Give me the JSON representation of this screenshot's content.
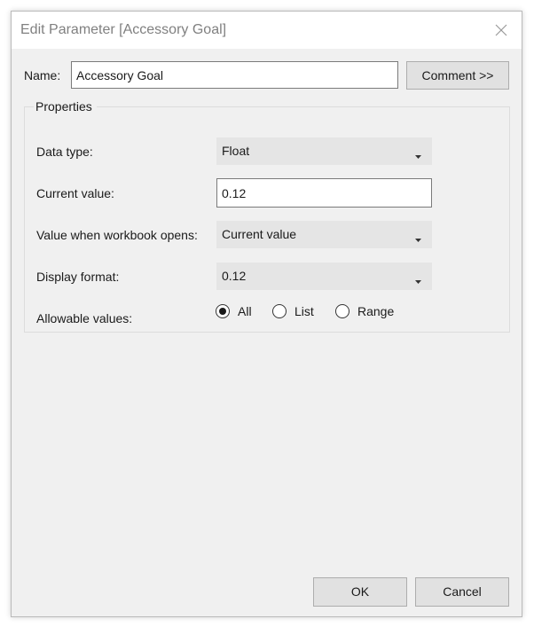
{
  "window": {
    "title": "Edit Parameter [Accessory Goal]"
  },
  "name": {
    "label": "Name:",
    "value": "Accessory Goal"
  },
  "buttons": {
    "comment": "Comment >>",
    "ok": "OK",
    "cancel": "Cancel"
  },
  "properties": {
    "legend": "Properties",
    "data_type": {
      "label": "Data type:",
      "value": "Float"
    },
    "current_value": {
      "label": "Current value:",
      "value": "0.12"
    },
    "workbook_opens": {
      "label": "Value when workbook opens:",
      "value": "Current value"
    },
    "display_format": {
      "label": "Display format:",
      "value": "0.12"
    },
    "allowable_values": {
      "label": "Allowable values:",
      "options": [
        {
          "label": "All",
          "selected": true
        },
        {
          "label": "List",
          "selected": false
        },
        {
          "label": "Range",
          "selected": false
        }
      ]
    }
  },
  "icons": {
    "close": "close-icon",
    "dropdown": "chevron-down-icon"
  },
  "colors": {
    "dialog_bg": "#f0f0f0",
    "combo_bg": "#e5e5e5",
    "button_bg": "#e1e1e1",
    "title_text": "#808080"
  }
}
